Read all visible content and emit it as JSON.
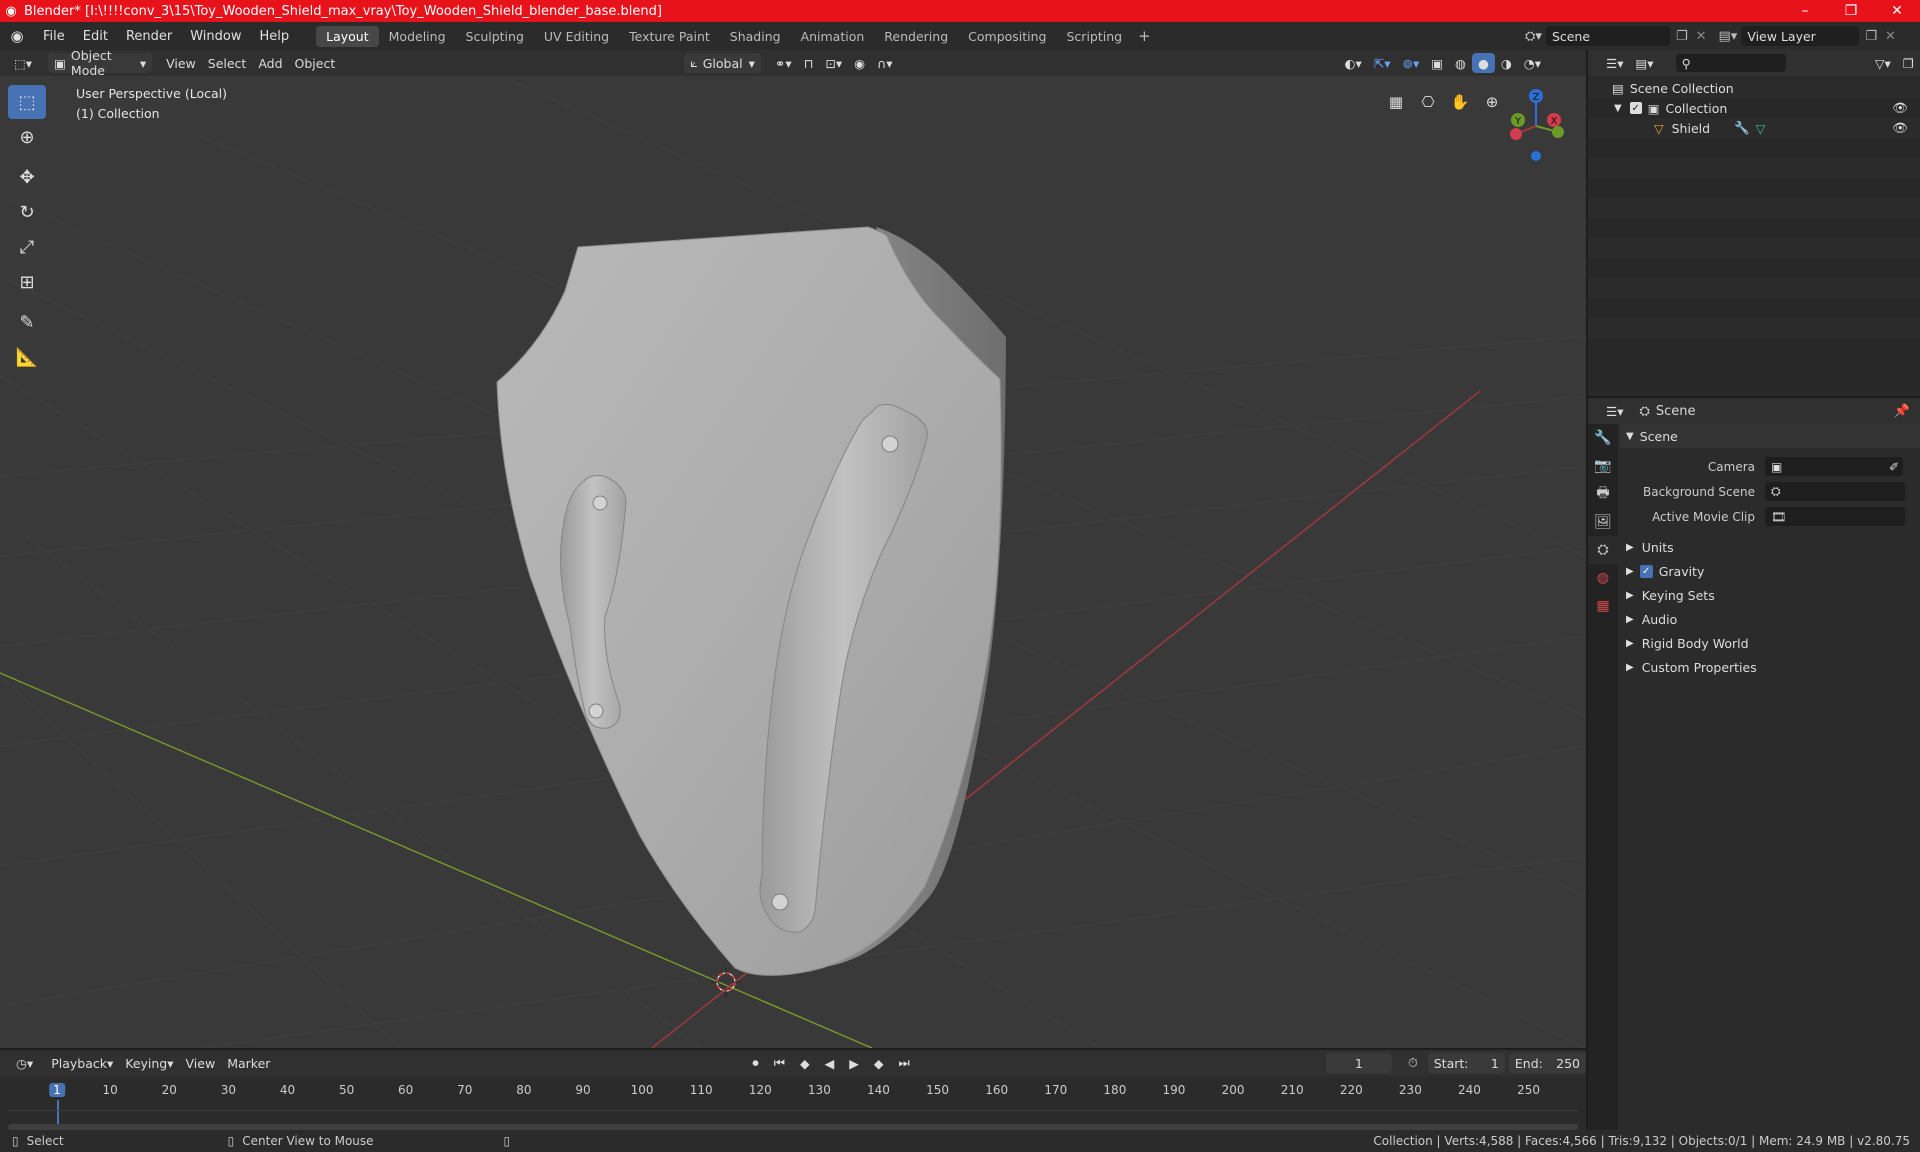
{
  "window": {
    "title": "Blender* [I:\\!!!!conv_3\\15\\Toy_Wooden_Shield_max_vray\\Toy_Wooden_Shield_blender_base.blend]",
    "minimize": "–",
    "maximize": "❐",
    "close": "✕"
  },
  "menu": [
    "File",
    "Edit",
    "Render",
    "Window",
    "Help"
  ],
  "workspaces": [
    "Layout",
    "Modeling",
    "Sculpting",
    "UV Editing",
    "Texture Paint",
    "Shading",
    "Animation",
    "Rendering",
    "Compositing",
    "Scripting"
  ],
  "active_workspace": "Layout",
  "scene_selector": "Scene",
  "view_layer": "View Layer",
  "viewport": {
    "mode": "Object Mode",
    "menus": [
      "View",
      "Select",
      "Add",
      "Object"
    ],
    "orientation": "Global",
    "perspective_label": "User Perspective (Local)",
    "collection_label": "(1) Collection"
  },
  "gizmo": {
    "z": "Z",
    "y": "Y",
    "x": "X"
  },
  "outliner": {
    "root": "Scene Collection",
    "collection": "Collection",
    "object": "Shield"
  },
  "properties": {
    "header": "Scene",
    "section": "Scene",
    "rows": [
      {
        "label": "Camera",
        "value": ""
      },
      {
        "label": "Background Scene",
        "value": ""
      },
      {
        "label": "Active Movie Clip",
        "value": ""
      }
    ],
    "panels": [
      "Units",
      "Gravity",
      "Keying Sets",
      "Audio",
      "Rigid Body World",
      "Custom Properties"
    ]
  },
  "timeline": {
    "menus": [
      "Playback",
      "Keying",
      "View",
      "Marker"
    ],
    "current_frame": "1",
    "start_label": "Start:",
    "start": "1",
    "end_label": "End:",
    "end": "250",
    "ticks": [
      "1",
      "10",
      "20",
      "30",
      "40",
      "50",
      "60",
      "70",
      "80",
      "90",
      "100",
      "110",
      "120",
      "130",
      "140",
      "150",
      "160",
      "170",
      "180",
      "190",
      "200",
      "210",
      "220",
      "230",
      "240",
      "250"
    ]
  },
  "status": {
    "left": "Select",
    "middle": "Center View to Mouse",
    "right": "Collection | Verts:4,588 | Faces:4,566 | Tris:9,132 | Objects:0/1 | Mem: 24.9 MB | v2.80.75"
  },
  "colors": {
    "titlebar": "#e8121b",
    "accent": "#4772b3",
    "x_axis": "#a8373f",
    "y_axis": "#7a9a2a"
  }
}
